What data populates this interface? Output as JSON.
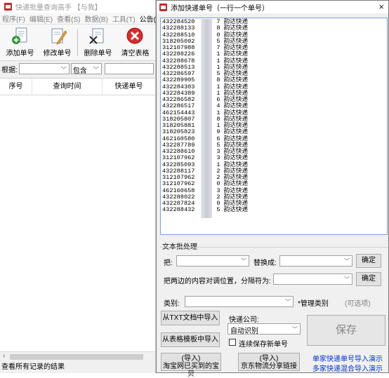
{
  "main_window": {
    "title": "快递批量查询高手 【与我】",
    "menu": [
      "程序(F)",
      "编辑(E)",
      "查看(S)",
      "数据(B)",
      "工具(T)",
      "公告(X)"
    ],
    "toolbar": {
      "add": "添加单号",
      "edit": "修改单号",
      "delete": "删除单号",
      "clear": "清空表格"
    },
    "filter": {
      "label": "根据:",
      "condition": "包含"
    },
    "columns": [
      "序号",
      "查询时间",
      "快递单号"
    ],
    "status": "查看所有记录的结果"
  },
  "dialog": {
    "title": "添加快递单号（一行一个单号）",
    "close": "×",
    "lines": [
      "432284520 ",
      "432288133 ",
      "432288510 ",
      "318205092 ",
      "312107988 ",
      "432288226 ",
      "432288678 ",
      "432288513 ",
      "432286597 ",
      "432289905 ",
      "432284303 ",
      "432284389 ",
      "432286582 ",
      "432286517 ",
      "462154443 ",
      "318205807 ",
      "318205881 ",
      "318205823 ",
      "462160580 ",
      "432287789 ",
      "432288610 ",
      "312107962 ",
      "432285093 ",
      "432288117 ",
      "312107962 ",
      "312107962 ",
      "462160658 ",
      "432288022 ",
      "432287824 ",
      "432288432 "
    ],
    "line_suffix_digits": [
      "7",
      "8",
      "0",
      "5",
      "7",
      "1",
      "1",
      "1",
      "5",
      "8",
      "1",
      "1",
      "6",
      "4",
      "1",
      "8",
      "1",
      "9",
      "6",
      "5",
      "3",
      "3",
      "1",
      "2",
      "2",
      "0",
      "3",
      "2",
      "0",
      "5"
    ],
    "carrier_text": "韵达快递",
    "batch": {
      "section_title": "文本批处理",
      "replace_from_label": "把:",
      "replace_to_label": "替换成:",
      "ok": "确定",
      "swap_label": "把两边的内容对调位置，分隔符为:",
      "ok2": "确定"
    },
    "category": {
      "label": "类别:",
      "manage": "*管理类别",
      "optional": "(可选项)"
    },
    "import_txt": "从TXT文档中导入",
    "import_template": "从表格模板中导入",
    "company_label": "快递公司:",
    "company_value": "自动识别",
    "continuous_label": "连续保存新单号",
    "save": "保存",
    "import_taobao_line1": "(导入)",
    "import_taobao_line2": "淘宝网已买到的宝贝",
    "import_jd_line1": "(导入)",
    "import_jd_line2": "京东物流分享链接",
    "demo1": "单家快递单号导入演示",
    "demo2": "多家快递混合导入演示"
  }
}
